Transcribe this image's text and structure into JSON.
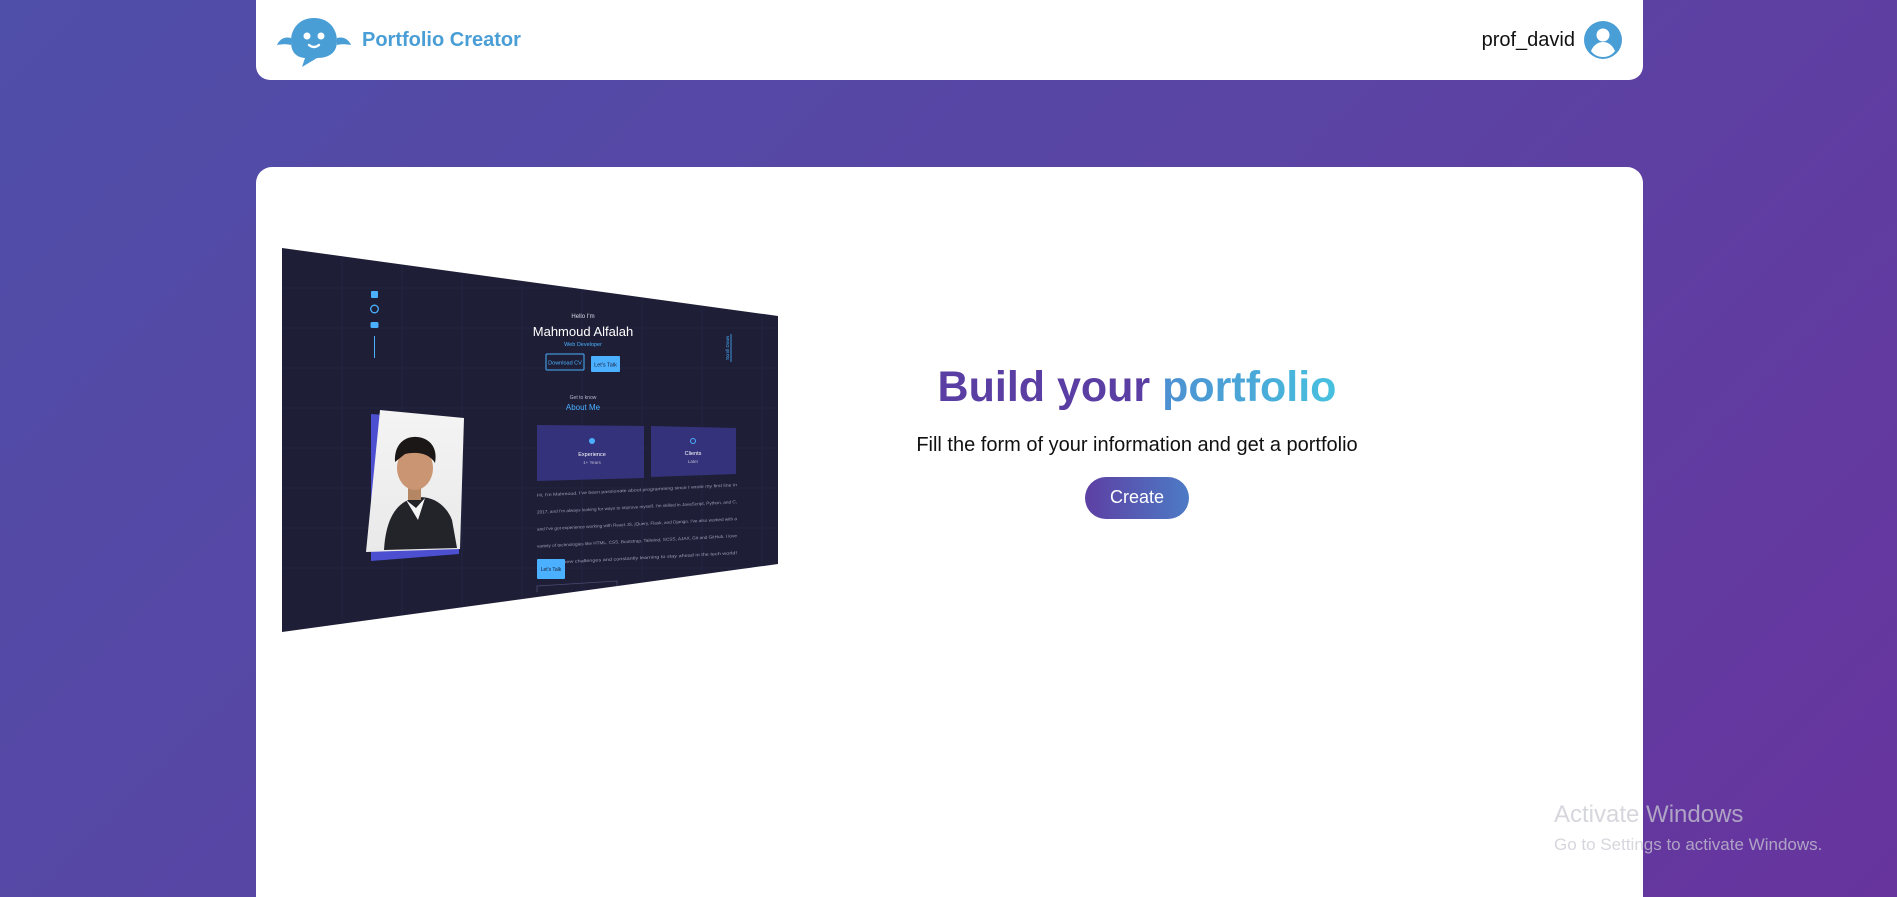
{
  "header": {
    "brand_name": "Portfolio Creator",
    "username": "prof_david",
    "logo_icon": "ghost-chat-icon",
    "avatar_icon": "user-circle-icon"
  },
  "preview": {
    "greeting": "Hello I'm",
    "name": "Mahmoud Alfalah",
    "role": "Web Developer",
    "download_cv": "Download CV",
    "lets_talk": "Let's Talk",
    "get_to_know": "Get to know",
    "about_me": "About Me",
    "experience_title": "Experience",
    "experience_value": "1+ Years",
    "clients_title": "Clients",
    "clients_value": "Later",
    "bio_lines": [
      "Hi, I'm Mahmoud. I've been passionate about programming since I wrote my first line in",
      "2017, and I'm always looking for ways to improve myself. I'm skilled in JavaScript, Python, and C,",
      "and I've got experience working with React JS, jQuery, Flask, and Django. I've also worked with a",
      "variety of technologies like HTML, CSS, Bootstrap, Tailwind, SCSS, AJAX, Git and GitHub. I love",
      "diving into new challenges and constantly learning to stay ahead in the tech world!"
    ],
    "bio_button": "Let's Talk",
    "scroll_label": "Scroll Down",
    "social_icons": [
      "linkedin-icon",
      "github-icon",
      "youtube-icon"
    ]
  },
  "hero": {
    "title_part1": "Build your",
    "title_part2": "portfolio",
    "subtitle": "Fill the form of your information and get a portfolio",
    "button_label": "Create"
  },
  "watermark": {
    "title": "Activate Windows",
    "subtitle": "Go to Settings to activate Windows."
  },
  "colors": {
    "background_start": "#4f4ea8",
    "background_end": "#67349e",
    "brand": "#4a9ed6",
    "title_purple": "#5b3ea3",
    "title_cyan": "#47c1df",
    "preview_bg": "#1e1f36",
    "preview_accent": "#4ab0ff"
  }
}
